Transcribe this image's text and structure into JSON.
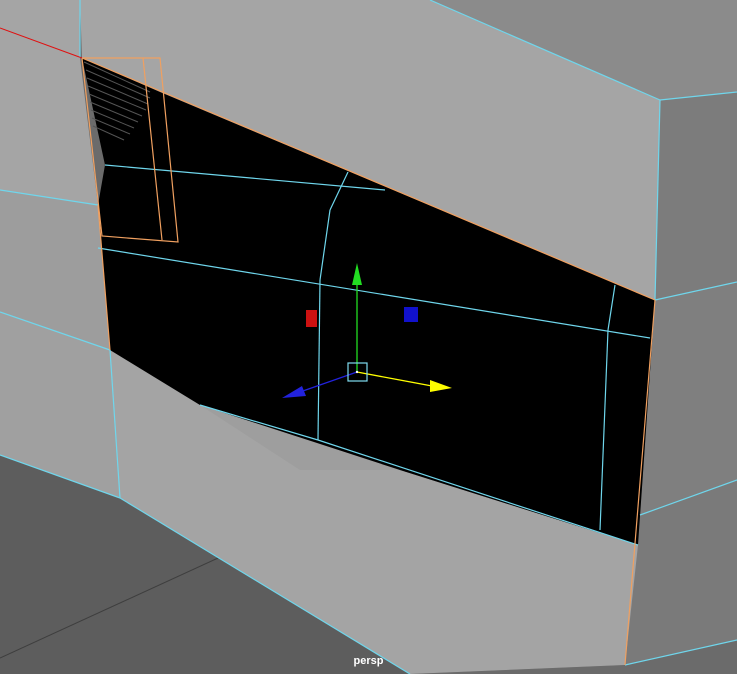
{
  "viewport": {
    "camera_name": "persp"
  },
  "colors": {
    "background": "#6b6b6b",
    "floor": "#5d5d5d",
    "mesh_face_light": "#a5a5a5",
    "mesh_face_mid": "#8d8d8d",
    "mesh_face_dark": "#7a7a7a",
    "selected_face": "#000000",
    "wireframe": "#6fd6ec",
    "selection_highlight": "#f0a060",
    "grid_line": "#3e3e3e",
    "axis_red": "#e01010",
    "manip_x": "#ffff00",
    "manip_y": "#22dd22",
    "manip_z": "#2222dd",
    "manip_center": "#7fdcf0",
    "plane_handle_red": "#cc1111",
    "plane_handle_blue": "#1111cc"
  },
  "manipulator": {
    "type": "move-tool",
    "axes": [
      "x",
      "y",
      "z"
    ]
  }
}
